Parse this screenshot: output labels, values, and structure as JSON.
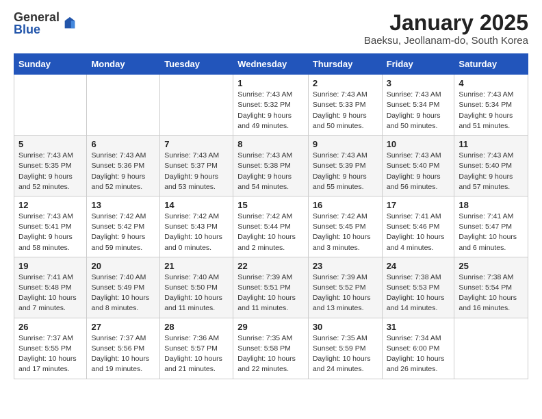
{
  "logo": {
    "general": "General",
    "blue": "Blue"
  },
  "title": "January 2025",
  "subtitle": "Baeksu, Jeollanam-do, South Korea",
  "days_of_week": [
    "Sunday",
    "Monday",
    "Tuesday",
    "Wednesday",
    "Thursday",
    "Friday",
    "Saturday"
  ],
  "weeks": [
    [
      {
        "day": "",
        "detail": ""
      },
      {
        "day": "",
        "detail": ""
      },
      {
        "day": "",
        "detail": ""
      },
      {
        "day": "1",
        "detail": "Sunrise: 7:43 AM\nSunset: 5:32 PM\nDaylight: 9 hours\nand 49 minutes."
      },
      {
        "day": "2",
        "detail": "Sunrise: 7:43 AM\nSunset: 5:33 PM\nDaylight: 9 hours\nand 50 minutes."
      },
      {
        "day": "3",
        "detail": "Sunrise: 7:43 AM\nSunset: 5:34 PM\nDaylight: 9 hours\nand 50 minutes."
      },
      {
        "day": "4",
        "detail": "Sunrise: 7:43 AM\nSunset: 5:34 PM\nDaylight: 9 hours\nand 51 minutes."
      }
    ],
    [
      {
        "day": "5",
        "detail": "Sunrise: 7:43 AM\nSunset: 5:35 PM\nDaylight: 9 hours\nand 52 minutes."
      },
      {
        "day": "6",
        "detail": "Sunrise: 7:43 AM\nSunset: 5:36 PM\nDaylight: 9 hours\nand 52 minutes."
      },
      {
        "day": "7",
        "detail": "Sunrise: 7:43 AM\nSunset: 5:37 PM\nDaylight: 9 hours\nand 53 minutes."
      },
      {
        "day": "8",
        "detail": "Sunrise: 7:43 AM\nSunset: 5:38 PM\nDaylight: 9 hours\nand 54 minutes."
      },
      {
        "day": "9",
        "detail": "Sunrise: 7:43 AM\nSunset: 5:39 PM\nDaylight: 9 hours\nand 55 minutes."
      },
      {
        "day": "10",
        "detail": "Sunrise: 7:43 AM\nSunset: 5:40 PM\nDaylight: 9 hours\nand 56 minutes."
      },
      {
        "day": "11",
        "detail": "Sunrise: 7:43 AM\nSunset: 5:40 PM\nDaylight: 9 hours\nand 57 minutes."
      }
    ],
    [
      {
        "day": "12",
        "detail": "Sunrise: 7:43 AM\nSunset: 5:41 PM\nDaylight: 9 hours\nand 58 minutes."
      },
      {
        "day": "13",
        "detail": "Sunrise: 7:42 AM\nSunset: 5:42 PM\nDaylight: 9 hours\nand 59 minutes."
      },
      {
        "day": "14",
        "detail": "Sunrise: 7:42 AM\nSunset: 5:43 PM\nDaylight: 10 hours\nand 0 minutes."
      },
      {
        "day": "15",
        "detail": "Sunrise: 7:42 AM\nSunset: 5:44 PM\nDaylight: 10 hours\nand 2 minutes."
      },
      {
        "day": "16",
        "detail": "Sunrise: 7:42 AM\nSunset: 5:45 PM\nDaylight: 10 hours\nand 3 minutes."
      },
      {
        "day": "17",
        "detail": "Sunrise: 7:41 AM\nSunset: 5:46 PM\nDaylight: 10 hours\nand 4 minutes."
      },
      {
        "day": "18",
        "detail": "Sunrise: 7:41 AM\nSunset: 5:47 PM\nDaylight: 10 hours\nand 6 minutes."
      }
    ],
    [
      {
        "day": "19",
        "detail": "Sunrise: 7:41 AM\nSunset: 5:48 PM\nDaylight: 10 hours\nand 7 minutes."
      },
      {
        "day": "20",
        "detail": "Sunrise: 7:40 AM\nSunset: 5:49 PM\nDaylight: 10 hours\nand 8 minutes."
      },
      {
        "day": "21",
        "detail": "Sunrise: 7:40 AM\nSunset: 5:50 PM\nDaylight: 10 hours\nand 11 minutes."
      },
      {
        "day": "22",
        "detail": "Sunrise: 7:39 AM\nSunset: 5:51 PM\nDaylight: 10 hours\nand 11 minutes."
      },
      {
        "day": "23",
        "detail": "Sunrise: 7:39 AM\nSunset: 5:52 PM\nDaylight: 10 hours\nand 13 minutes."
      },
      {
        "day": "24",
        "detail": "Sunrise: 7:38 AM\nSunset: 5:53 PM\nDaylight: 10 hours\nand 14 minutes."
      },
      {
        "day": "25",
        "detail": "Sunrise: 7:38 AM\nSunset: 5:54 PM\nDaylight: 10 hours\nand 16 minutes."
      }
    ],
    [
      {
        "day": "26",
        "detail": "Sunrise: 7:37 AM\nSunset: 5:55 PM\nDaylight: 10 hours\nand 17 minutes."
      },
      {
        "day": "27",
        "detail": "Sunrise: 7:37 AM\nSunset: 5:56 PM\nDaylight: 10 hours\nand 19 minutes."
      },
      {
        "day": "28",
        "detail": "Sunrise: 7:36 AM\nSunset: 5:57 PM\nDaylight: 10 hours\nand 21 minutes."
      },
      {
        "day": "29",
        "detail": "Sunrise: 7:35 AM\nSunset: 5:58 PM\nDaylight: 10 hours\nand 22 minutes."
      },
      {
        "day": "30",
        "detail": "Sunrise: 7:35 AM\nSunset: 5:59 PM\nDaylight: 10 hours\nand 24 minutes."
      },
      {
        "day": "31",
        "detail": "Sunrise: 7:34 AM\nSunset: 6:00 PM\nDaylight: 10 hours\nand 26 minutes."
      },
      {
        "day": "",
        "detail": ""
      }
    ]
  ]
}
